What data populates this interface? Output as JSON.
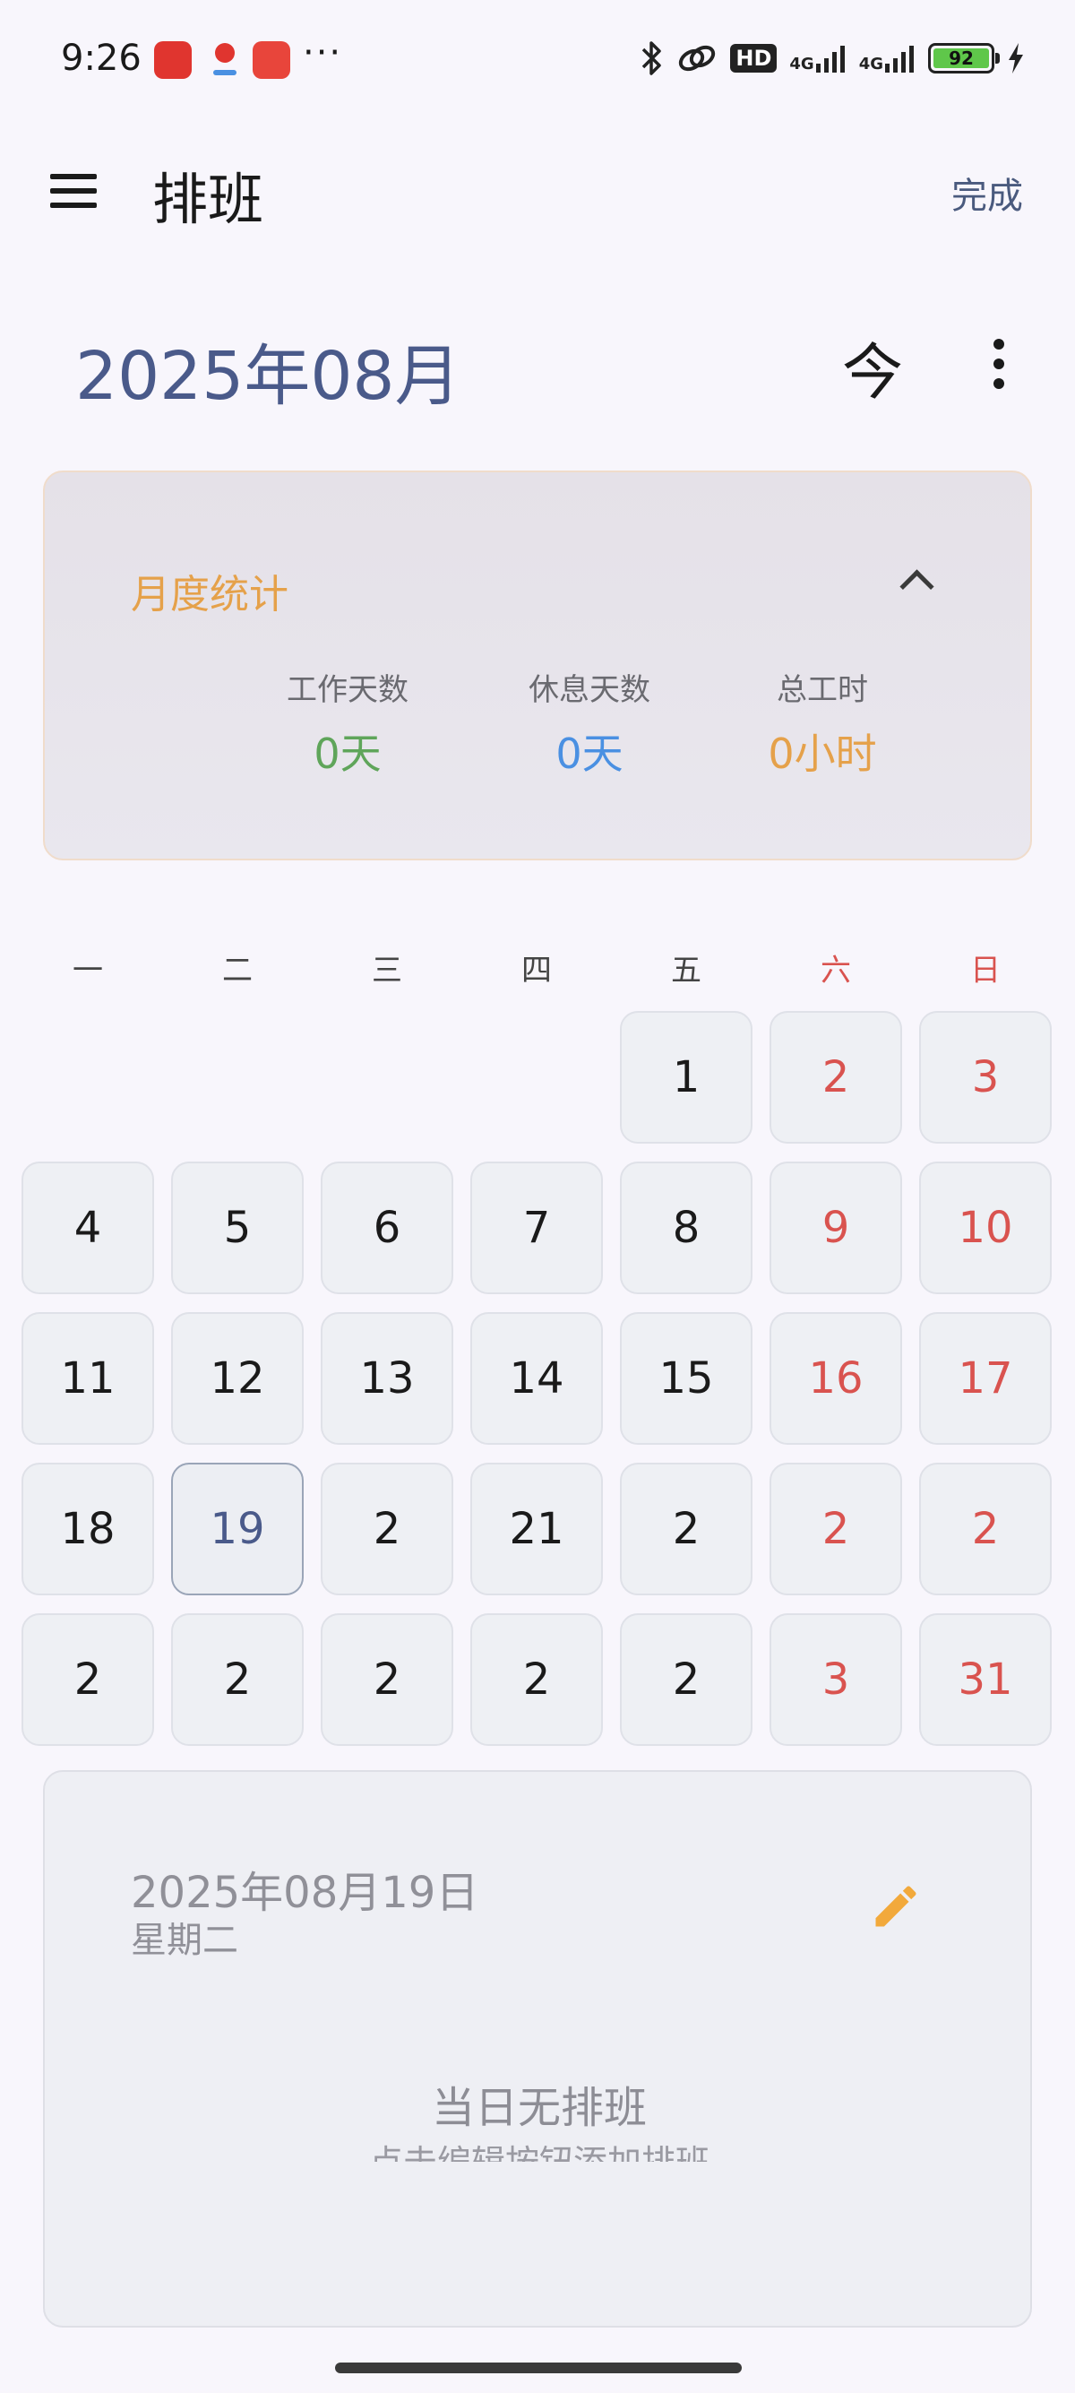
{
  "status_bar": {
    "time": "9:26",
    "more": "···",
    "hd": "HD",
    "signal1": "4G",
    "signal2": "4G",
    "battery_level": "92",
    "icons": [
      "bluetooth-icon",
      "link-icon",
      "hd-icon",
      "signal-icon",
      "signal-icon",
      "battery-icon",
      "charging-icon"
    ]
  },
  "app_bar": {
    "title": "排班",
    "done_label": "完成"
  },
  "month_header": {
    "title": "2025年08月",
    "today_label": "今"
  },
  "stats": {
    "title": "月度统计",
    "work_days_label": "工作天数",
    "work_days_value": "0天",
    "rest_days_label": "休息天数",
    "rest_days_value": "0天",
    "total_hours_label": "总工时",
    "total_hours_value": "0小时",
    "colors": {
      "title": "#e5a14a",
      "work": "#5fa55a",
      "rest": "#4a90e2",
      "hours": "#e5a14a"
    }
  },
  "weekdays": [
    "一",
    "二",
    "三",
    "四",
    "五",
    "六",
    "日"
  ],
  "weekday_colors": {
    "weekday": "#444444",
    "weekend": "#d9534f"
  },
  "calendar": {
    "weeks": [
      [
        "",
        "",
        "",
        "",
        "1",
        "2",
        "3"
      ],
      [
        "4",
        "5",
        "6",
        "7",
        "8",
        "9",
        "10"
      ],
      [
        "11",
        "12",
        "13",
        "14",
        "15",
        "16",
        "17"
      ],
      [
        "18",
        "19",
        "2",
        "21",
        "2",
        "2",
        "2"
      ],
      [
        "2",
        "2",
        "2",
        "2",
        "2",
        "3",
        "31"
      ]
    ],
    "selected_day": "19"
  },
  "detail": {
    "date": "2025年08月19日",
    "weekday": "星期二",
    "empty_text": "当日无排班",
    "hint_text": "点击编辑按钮添加排班"
  }
}
